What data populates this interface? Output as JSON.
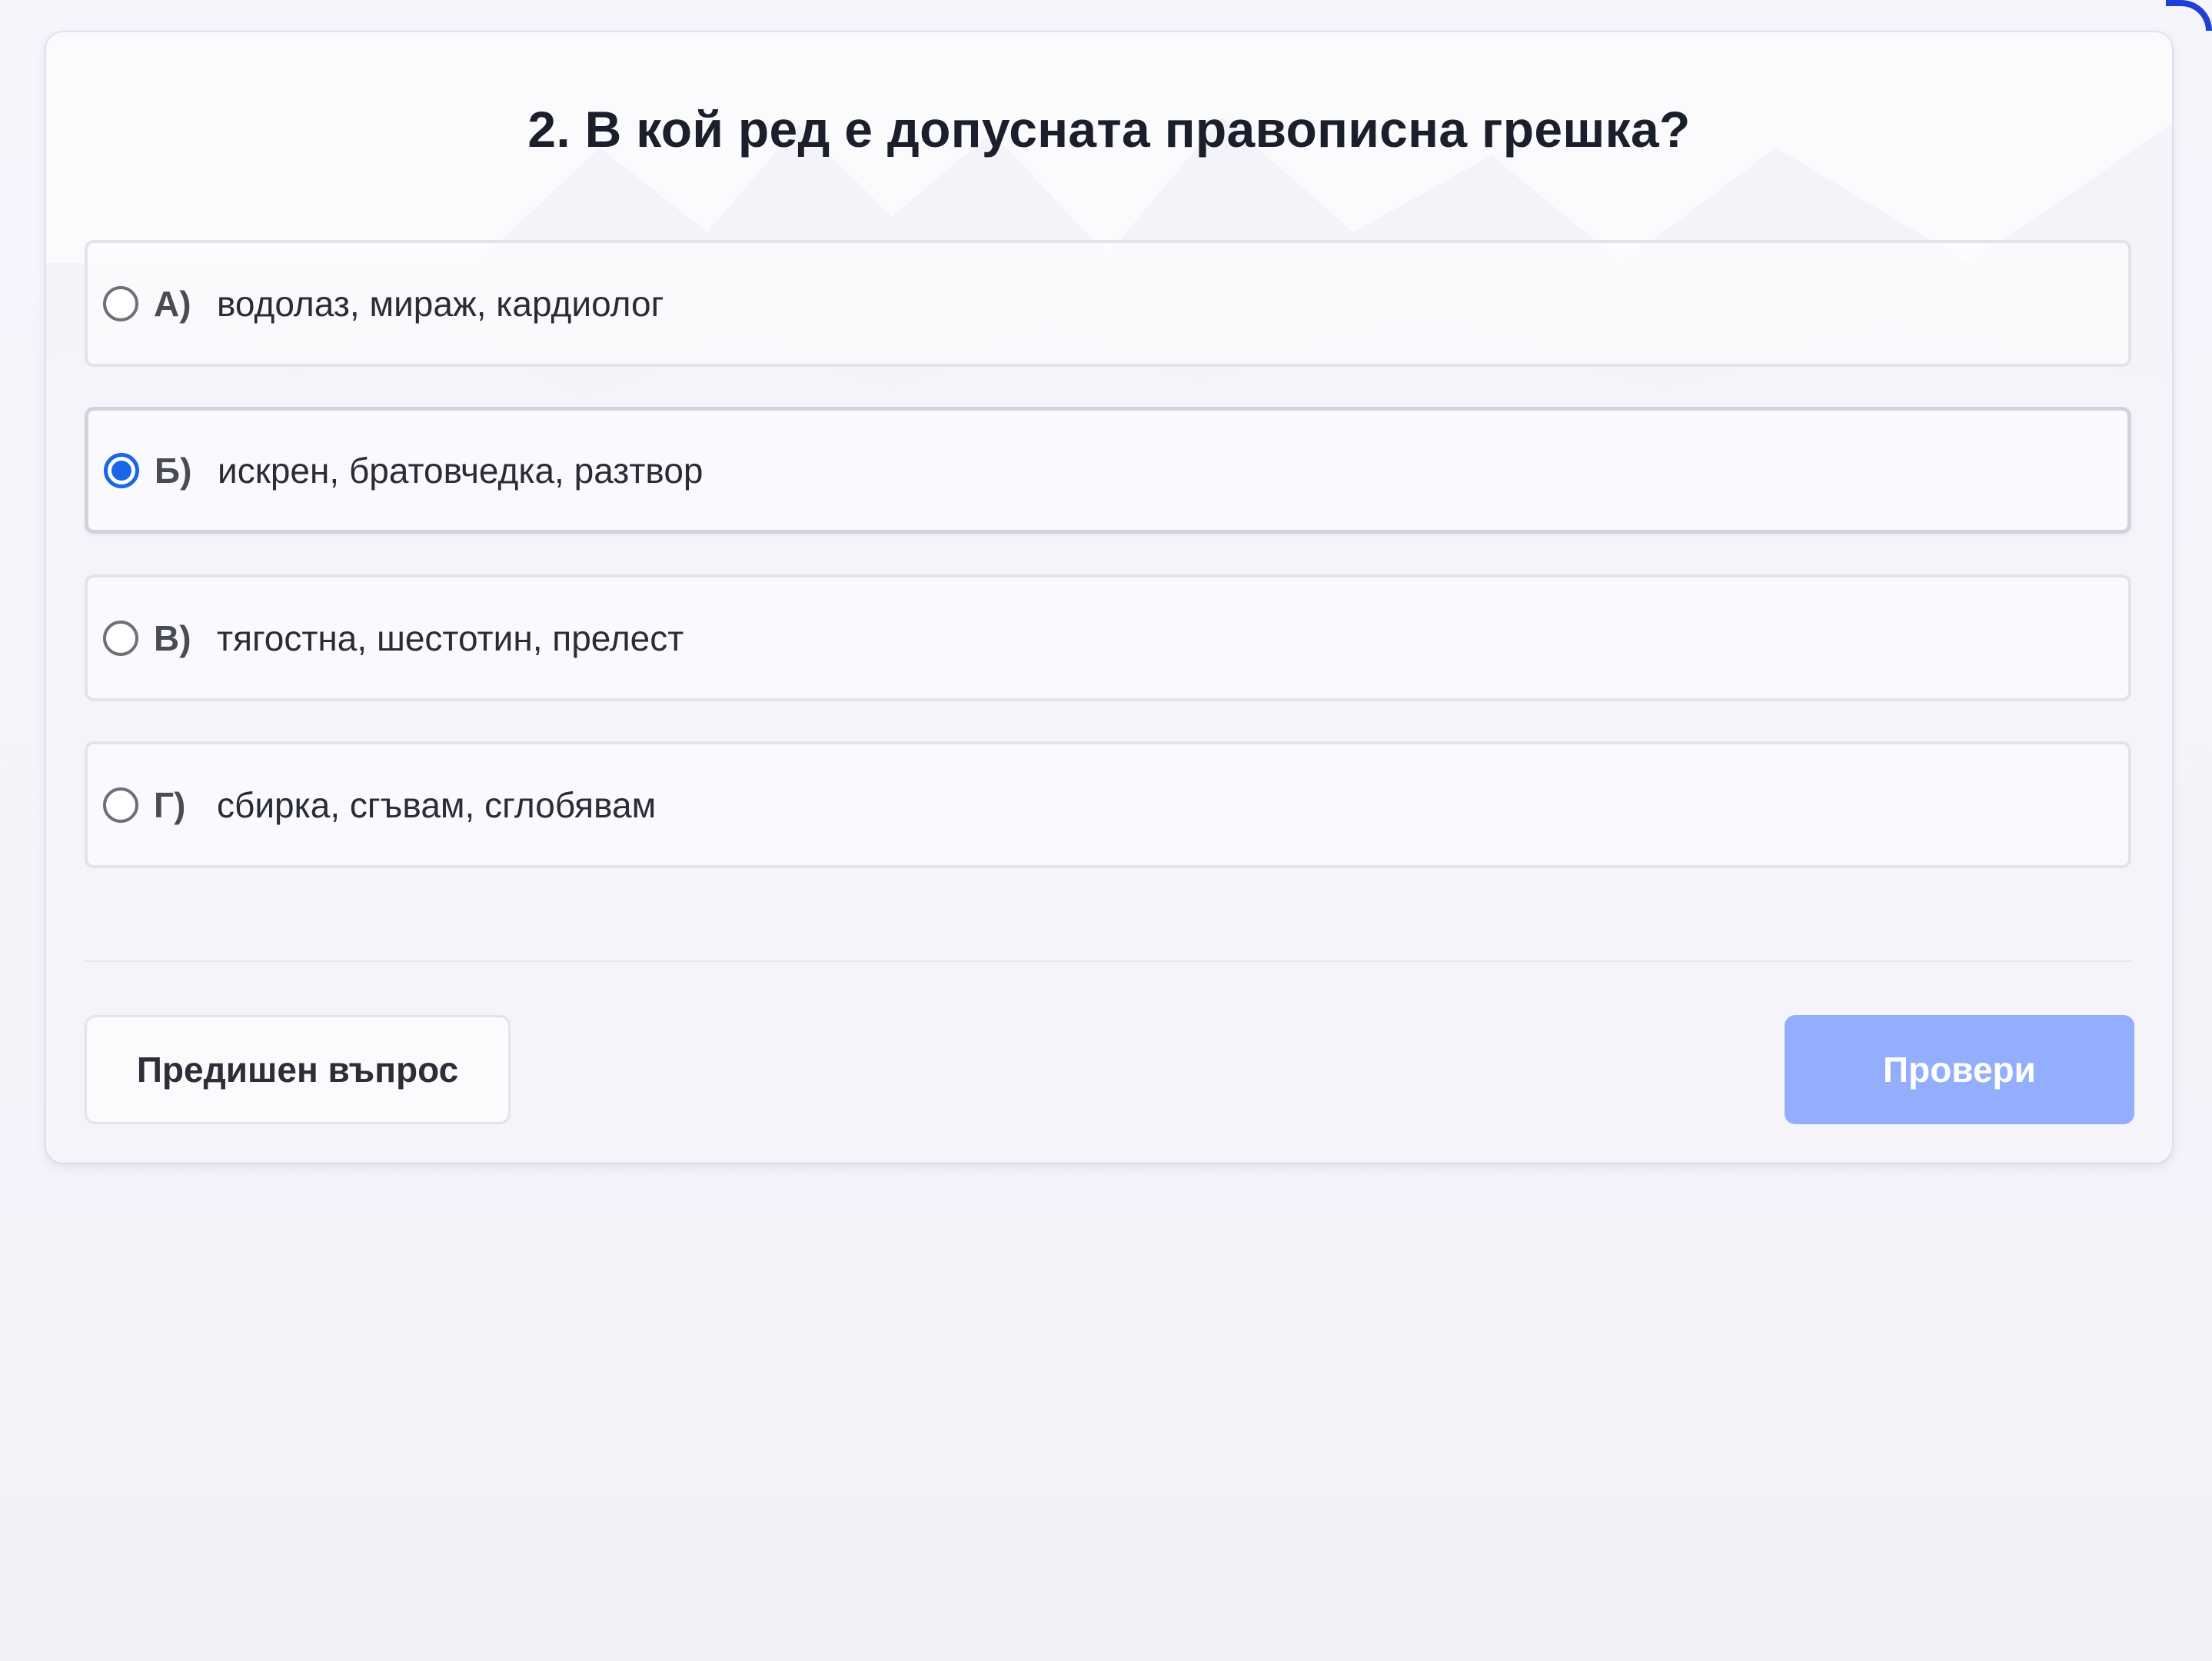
{
  "question": {
    "title": "2. В кой ред е допусната правописна грешка?"
  },
  "options": [
    {
      "letter": "А)",
      "text": "водолаз, мираж, кардиолог",
      "selected": false
    },
    {
      "letter": "Б)",
      "text": "искрен, братовчедка, разтвор",
      "selected": true
    },
    {
      "letter": "В)",
      "text": "тягостна, шестотин, прелест",
      "selected": false
    },
    {
      "letter": "Г)",
      "text": "сбирка, сгъвам, сглобявам",
      "selected": false
    }
  ],
  "actions": {
    "previous_label": "Предишен въпрос",
    "check_label": "Провери",
    "check_enabled": false
  },
  "colors": {
    "accent": "#1a66e8",
    "check_button_disabled": "#93aefc",
    "page_background": "#f5f4fb",
    "card_background": "#fbfbfe"
  }
}
